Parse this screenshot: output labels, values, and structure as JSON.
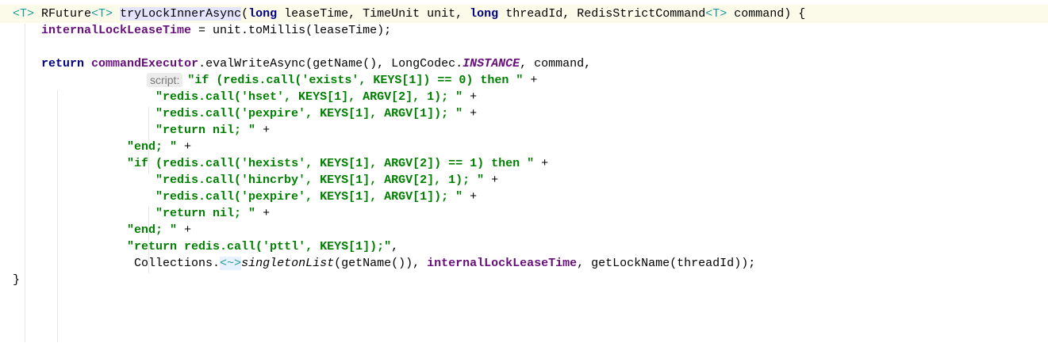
{
  "editor": {
    "language": "java",
    "colors": {
      "keyword": "#000080",
      "field": "#660e7a",
      "string": "#008000",
      "type_param": "#20999d",
      "selection_highlight": "#e4e4ff",
      "current_line": "#fcfbe9"
    },
    "lines": [
      {
        "tokens": [
          {
            "t": "<T>",
            "c": "type"
          },
          {
            "t": " RFuture"
          },
          {
            "t": "<T>",
            "c": "type"
          },
          {
            "t": " "
          },
          {
            "t": "tryLockInnerAsync",
            "c": "hl"
          },
          {
            "t": "("
          },
          {
            "t": "long",
            "c": "kw"
          },
          {
            "t": " leaseTime, TimeUnit unit, "
          },
          {
            "t": "long",
            "c": "kw"
          },
          {
            "t": " threadId, RedisStrictCommand"
          },
          {
            "t": "<T>",
            "c": "type"
          },
          {
            "t": " command) {"
          }
        ]
      },
      {
        "tokens": [
          {
            "t": "    "
          },
          {
            "t": "internalLockLeaseTime",
            "c": "field"
          },
          {
            "t": " = unit.toMillis(leaseTime);"
          }
        ]
      },
      {
        "tokens": []
      },
      {
        "tokens": [
          {
            "t": "    "
          },
          {
            "t": "return",
            "c": "kw"
          },
          {
            "t": " "
          },
          {
            "t": "commandExecutor",
            "c": "field"
          },
          {
            "t": ".evalWriteAsync(getName(), LongCodec."
          },
          {
            "t": "INSTANCE",
            "c": "static"
          },
          {
            "t": ", command,"
          }
        ]
      },
      {
        "hint": "script:",
        "tokens": [
          {
            "t": "\"if (redis.call('exists', KEYS[1]) == 0) then \"",
            "c": "str"
          },
          {
            "t": " +"
          }
        ]
      },
      {
        "tokens": [
          {
            "t": "                    "
          },
          {
            "t": "\"redis.call('hset', KEYS[1], ARGV[2], 1); \"",
            "c": "str"
          },
          {
            "t": " +"
          }
        ]
      },
      {
        "tokens": [
          {
            "t": "                    "
          },
          {
            "t": "\"redis.call('pexpire', KEYS[1], ARGV[1]); \"",
            "c": "str"
          },
          {
            "t": " +"
          }
        ]
      },
      {
        "tokens": [
          {
            "t": "                    "
          },
          {
            "t": "\"return nil; \"",
            "c": "str"
          },
          {
            "t": " +"
          }
        ]
      },
      {
        "tokens": [
          {
            "t": "                "
          },
          {
            "t": "\"end; \"",
            "c": "str"
          },
          {
            "t": " +"
          }
        ]
      },
      {
        "tokens": [
          {
            "t": "                "
          },
          {
            "t": "\"if (redis.call('hexists', KEYS[1], ARGV[2]) == 1) then \"",
            "c": "str"
          },
          {
            "t": " +"
          }
        ]
      },
      {
        "tokens": [
          {
            "t": "                    "
          },
          {
            "t": "\"redis.call('hincrby', KEYS[1], ARGV[2], 1); \"",
            "c": "str"
          },
          {
            "t": " +"
          }
        ]
      },
      {
        "tokens": [
          {
            "t": "                    "
          },
          {
            "t": "\"redis.call('pexpire', KEYS[1], ARGV[1]); \"",
            "c": "str"
          },
          {
            "t": " +"
          }
        ]
      },
      {
        "tokens": [
          {
            "t": "                    "
          },
          {
            "t": "\"return nil; \"",
            "c": "str"
          },
          {
            "t": " +"
          }
        ]
      },
      {
        "tokens": [
          {
            "t": "                "
          },
          {
            "t": "\"end; \"",
            "c": "str"
          },
          {
            "t": " +"
          }
        ]
      },
      {
        "tokens": [
          {
            "t": "                "
          },
          {
            "t": "\"return redis.call('pttl', KEYS[1]);\"",
            "c": "str"
          },
          {
            "t": ","
          }
        ]
      },
      {
        "tokens": [
          {
            "t": "                 Collections."
          },
          {
            "t": "<~>",
            "c": "fold"
          },
          {
            "t": "singletonList",
            "c": "italic"
          },
          {
            "t": "(getName()), "
          },
          {
            "t": "internalLockLeaseTime",
            "c": "field"
          },
          {
            "t": ", getLockName(threadId));"
          }
        ]
      },
      {
        "tokens": [
          {
            "t": "}"
          }
        ]
      }
    ]
  }
}
